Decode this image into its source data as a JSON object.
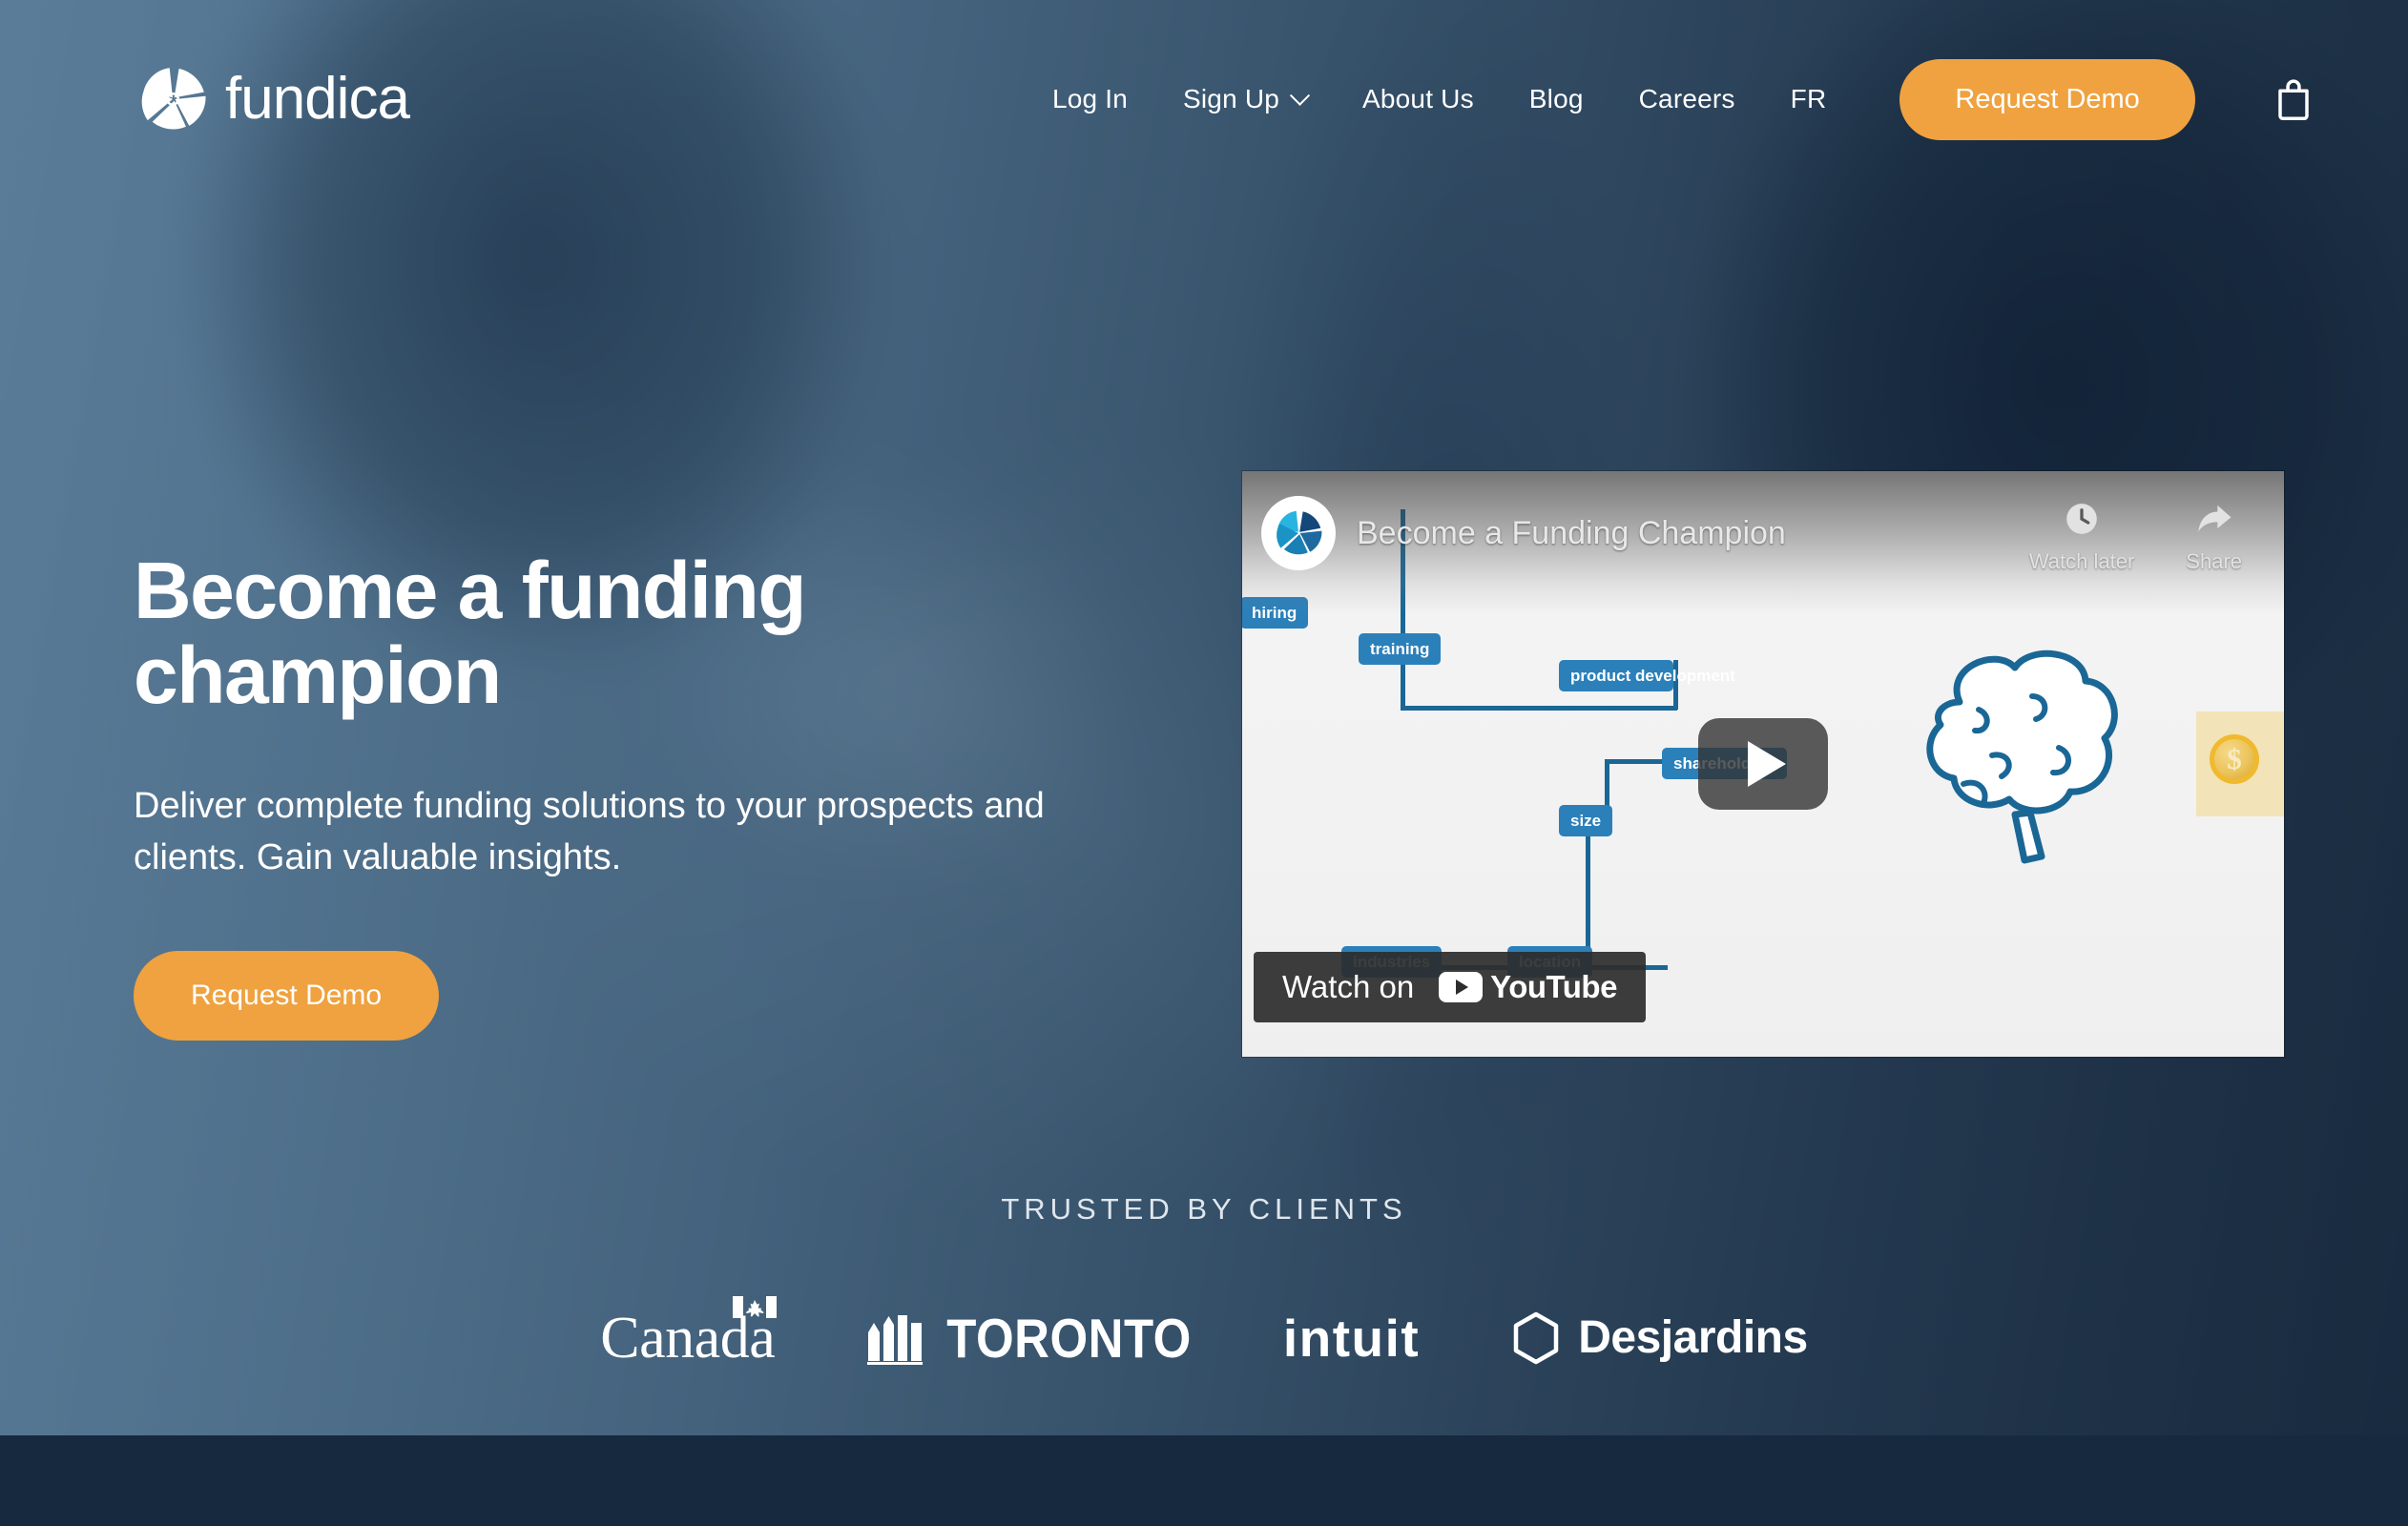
{
  "brand": {
    "name": "fundica",
    "logo_icon": "aperture-pinwheel-icon"
  },
  "nav": {
    "links": [
      {
        "label": "Log In",
        "icon": null
      },
      {
        "label": "Sign Up",
        "icon": "chevron-down-icon"
      },
      {
        "label": "About Us",
        "icon": null
      },
      {
        "label": "Blog",
        "icon": null
      },
      {
        "label": "Careers",
        "icon": null
      },
      {
        "label": "FR",
        "icon": null
      }
    ],
    "cta_label": "Request Demo",
    "cart_icon": "shopping-bag-icon"
  },
  "hero": {
    "title": "Become a funding champion",
    "subtitle": "Deliver complete funding solutions to your prospects and clients. Gain valuable insights.",
    "cta_label": "Request Demo"
  },
  "video": {
    "title": "Become a Funding Champion",
    "avatar_icon": "fundica-pinwheel-avatar-icon",
    "watch_later_label": "Watch later",
    "watch_later_icon": "clock-icon",
    "share_label": "Share",
    "share_icon": "share-arrow-icon",
    "play_icon": "play-button-icon",
    "watch_on_label": "Watch on",
    "platform": "YouTube",
    "platform_icon": "youtube-play-icon",
    "thumbnail_nodes": [
      "hiring",
      "training",
      "product development",
      "shareholders",
      "size",
      "industries",
      "location"
    ],
    "thumbnail_coin_symbol": "$"
  },
  "trusted": {
    "label": "TRUSTED BY CLIENTS",
    "clients": [
      {
        "name": "Canada",
        "icon": "canada-flag-icon"
      },
      {
        "name": "TORONTO",
        "icon": "toronto-buildings-icon"
      },
      {
        "name": "intuit",
        "icon": null
      },
      {
        "name": "Desjardins",
        "icon": "desjardins-hexagon-icon"
      }
    ]
  },
  "colors": {
    "accent_orange": "#efa23f",
    "hero_blue_light": "#5d7f9c",
    "hero_blue_dark": "#1b2e42",
    "footer_navy": "#17293f",
    "node_blue": "#2b80ba",
    "coin_gold": "#f0b92e"
  }
}
